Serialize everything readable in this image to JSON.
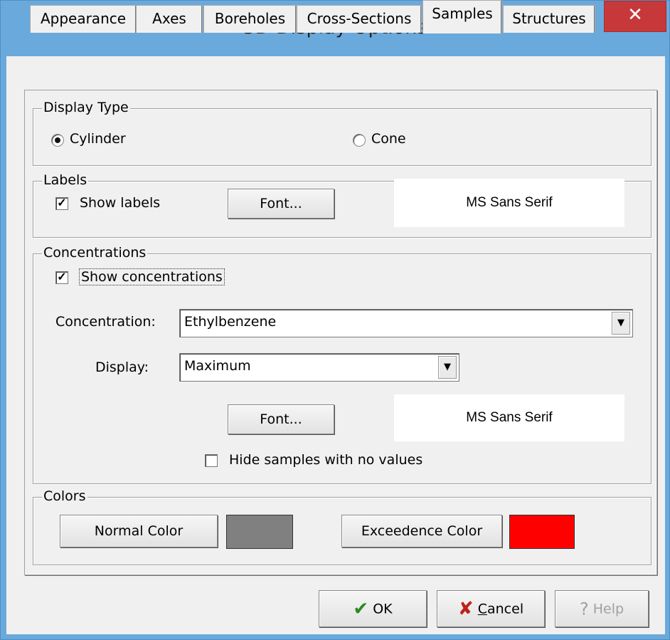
{
  "window": {
    "title": "3D Display Options",
    "help_glyph": "?",
    "close_glyph": "✕"
  },
  "tabs": [
    {
      "label": "Appearance"
    },
    {
      "label": "Axes"
    },
    {
      "label": "Boreholes"
    },
    {
      "label": "Cross-Sections"
    },
    {
      "label": "Samples",
      "active": true
    },
    {
      "label": "Structures"
    }
  ],
  "display_type": {
    "title": "Display Type",
    "options": [
      {
        "label": "Cylinder",
        "selected": true
      },
      {
        "label": "Cone",
        "selected": false
      }
    ]
  },
  "labels": {
    "title": "Labels",
    "show_labels": "Show labels",
    "show_labels_checked": true,
    "font_button": "Font...",
    "font_name": "MS Sans Serif"
  },
  "concentrations": {
    "title": "Concentrations",
    "show_concentrations": "Show concentrations",
    "show_checked": true,
    "concentration_label": "Concentration:",
    "concentration_value": "Ethylbenzene",
    "display_label": "Display:",
    "display_value": "Maximum",
    "font_button": "Font...",
    "font_name": "MS Sans Serif",
    "hide_samples": "Hide samples with no values",
    "hide_checked": false
  },
  "colors": {
    "title": "Colors",
    "normal_button": "Normal Color",
    "normal_color": "#808080",
    "exceedence_button": "Exceedence Color",
    "exceedence_color": "#ff0000"
  },
  "buttons": {
    "ok": "OK",
    "cancel_prefix": "C",
    "cancel_rest": "ancel",
    "help": "Help"
  }
}
